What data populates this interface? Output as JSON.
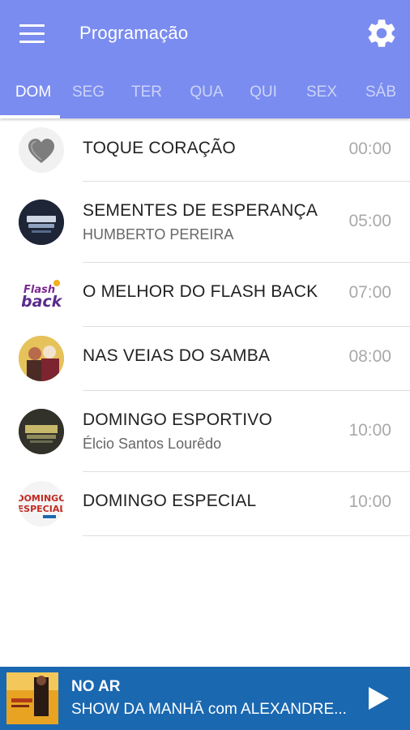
{
  "header": {
    "title": "Programação",
    "menu_icon": "menu-icon",
    "settings_icon": "gear-icon",
    "background_color": "#7a8cef"
  },
  "tabs": [
    {
      "label": "DOM",
      "active": true
    },
    {
      "label": "SEG",
      "active": false
    },
    {
      "label": "TER",
      "active": false
    },
    {
      "label": "QUA",
      "active": false
    },
    {
      "label": "QUI",
      "active": false
    },
    {
      "label": "SEX",
      "active": false
    },
    {
      "label": "SÁB",
      "active": false
    }
  ],
  "schedule": [
    {
      "title": "TOQUE CORAÇÃO",
      "subtitle": "",
      "time": "00:00",
      "thumb": "heart-logo"
    },
    {
      "title": "SEMENTES DE ESPERANÇA",
      "subtitle": "HUMBERTO PEREIRA",
      "time": "05:00",
      "thumb": "sementes-logo"
    },
    {
      "title": "O MELHOR DO FLASH BACK",
      "subtitle": "",
      "time": "07:00",
      "thumb": "flash-back-logo",
      "thumb_text_1": "Flash",
      "thumb_text_2": "back"
    },
    {
      "title": "NAS VEIAS DO SAMBA",
      "subtitle": "",
      "time": "08:00",
      "thumb": "samba-photo"
    },
    {
      "title": "DOMINGO ESPORTIVO",
      "subtitle": "Élcio Santos Lourêdo",
      "time": "10:00",
      "thumb": "esportivo-logo"
    },
    {
      "title": "DOMINGO ESPECIAL",
      "subtitle": "",
      "time": "10:00",
      "thumb": "domingo-especial-logo",
      "thumb_text_1": "DOMINGO",
      "thumb_text_2": "ESPECIAL"
    }
  ],
  "player": {
    "label": "NO AR",
    "show": "SHOW DA MANHÃ com ALEXANDRE...",
    "play_icon": "play-icon",
    "background_color": "#1a68b0"
  }
}
